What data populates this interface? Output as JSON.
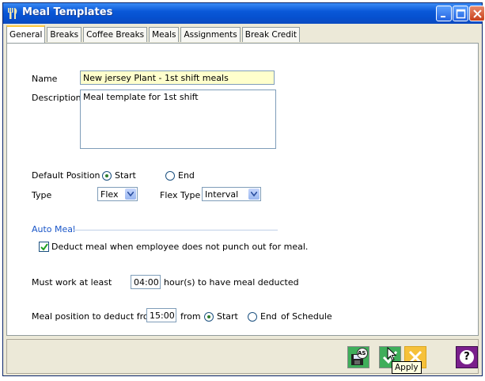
{
  "window": {
    "title": "Meal Templates"
  },
  "tabs": [
    {
      "label": "General",
      "active": true
    },
    {
      "label": "Breaks"
    },
    {
      "label": "Coffee Breaks"
    },
    {
      "label": "Meals"
    },
    {
      "label": "Assignments"
    },
    {
      "label": "Break Credit"
    }
  ],
  "form": {
    "name_label": "Name",
    "name_value": "New jersey Plant - 1st shift meals",
    "description_label": "Description",
    "description_value": "Meal template for 1st shift",
    "default_position_label": "Default Position",
    "position_start": "Start",
    "position_end": "End",
    "position_selected": "Start",
    "type_label": "Type",
    "type_value": "Flex",
    "flex_type_label": "Flex Type",
    "flex_type_value": "Interval"
  },
  "auto_meal": {
    "section_title": "Auto Meal",
    "deduct_label": "Deduct meal when employee does not punch out for meal.",
    "deduct_checked": true,
    "must_work_prefix": "Must work at least",
    "must_work_value": "04:00",
    "must_work_suffix": "hour(s) to have meal deducted",
    "position_prefix": "Meal position to deduct from",
    "position_value": "15:00",
    "position_from": "from",
    "position_start": "Start",
    "position_end": "End",
    "position_suffix": "of Schedule",
    "position_selected": "Start"
  },
  "toolbar": {
    "save_as_icon": "save-as-icon",
    "save_as_badge": "AS",
    "apply_icon": "apply-check-icon",
    "cancel_icon": "cancel-icon",
    "help_icon": "help-icon",
    "help_glyph": "?",
    "tooltip": "Apply"
  },
  "colors": {
    "titlebar": "#0a58d8",
    "name_field_bg": "#ffffcc",
    "section_title": "#1a56c8",
    "active_tab_accent": "#ffc83c"
  }
}
